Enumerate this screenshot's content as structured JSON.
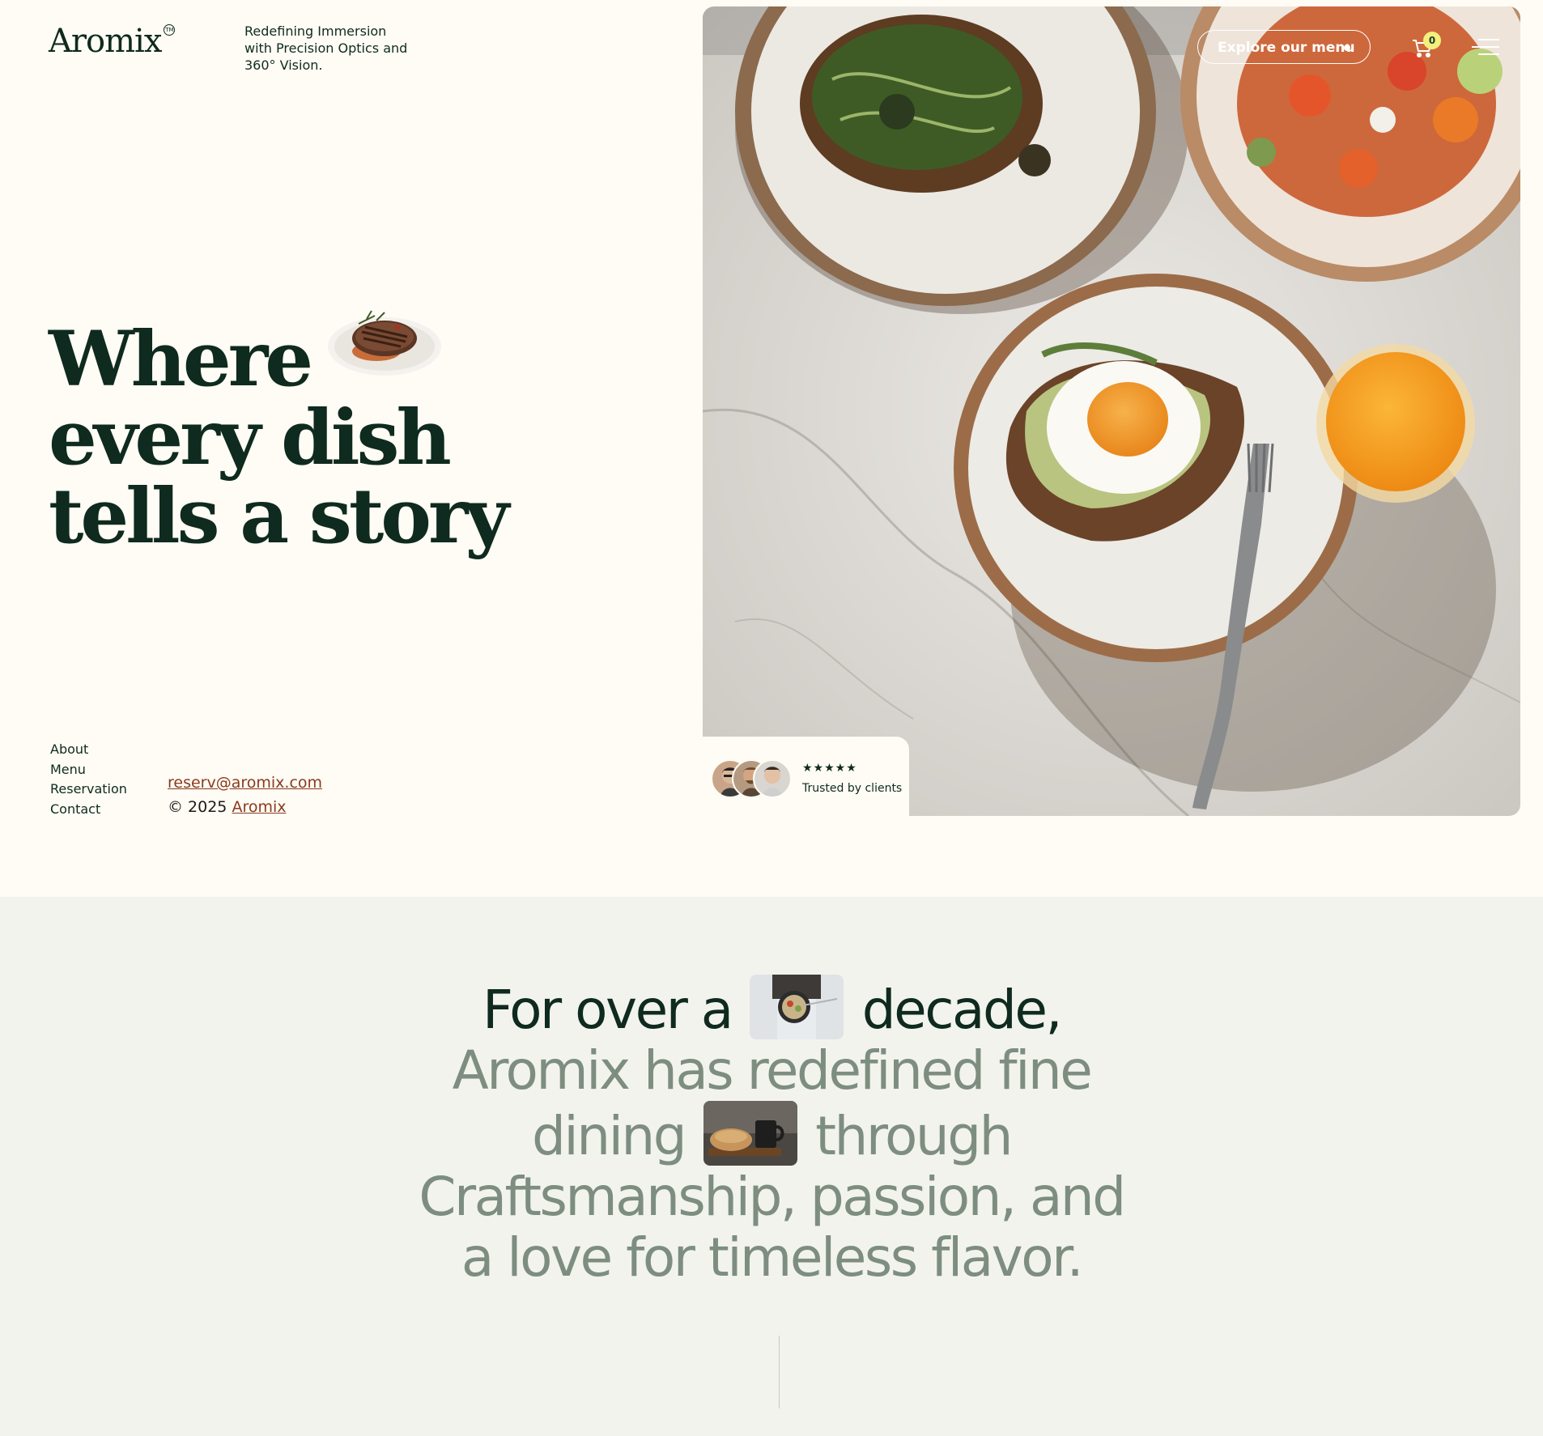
{
  "brand": {
    "name": "Aromix",
    "trademark": "TM"
  },
  "tagline": [
    "Redefining Immersion",
    "with Precision Optics and",
    "360° Vision."
  ],
  "hero": {
    "headline_lines": [
      "Where",
      "every dish",
      "tells a story"
    ]
  },
  "header": {
    "cta_label": "Explore our menu",
    "cart_count": "0"
  },
  "footer_nav": [
    "About",
    "Menu",
    "Reservation",
    "Contact"
  ],
  "contact": {
    "email": "reserv@aromix.com",
    "copyright_prefix": "© 2025",
    "copyright_link": "Aromix"
  },
  "trust": {
    "stars": "★★★★★",
    "label": "Trusted by clients",
    "rating": 5
  },
  "story": {
    "line1_a": "For over a",
    "line1_b": "decade,",
    "line2": "Aromix has redefined fine",
    "line3_a": "dining",
    "line3_b": "through",
    "line4": "Craftsmanship, passion, and",
    "line5": "a love for timeless flavor."
  },
  "colors": {
    "bg_hero": "#fefcf4",
    "bg_story": "#f3f3ed",
    "ink": "#0f2a1f",
    "muted": "#7d8e80",
    "link": "#8b3a1e",
    "badge": "#f4ef7c"
  }
}
